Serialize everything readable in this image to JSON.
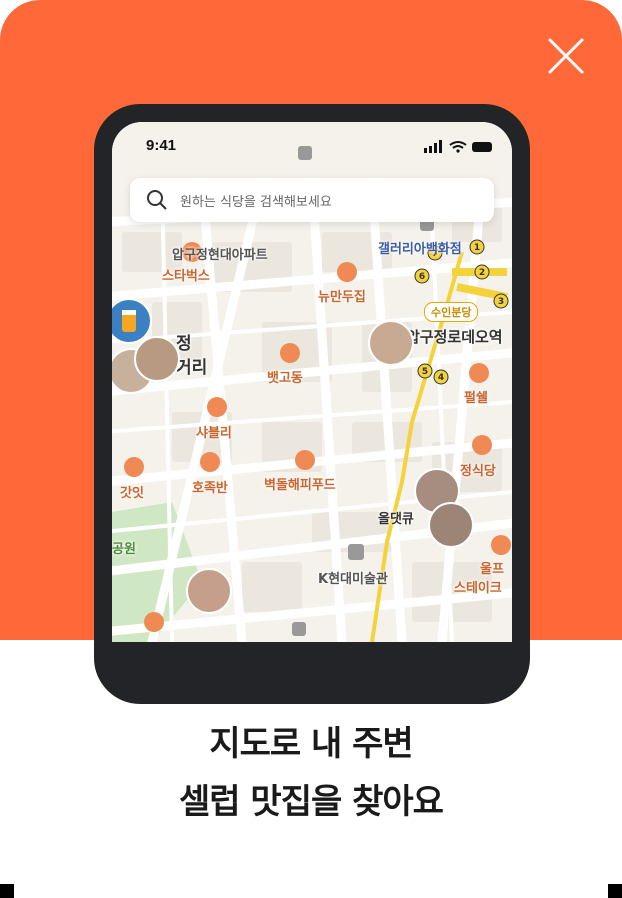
{
  "colors": {
    "accent": "#FF6838",
    "mapBg": "#F5F2EC",
    "road": "#FFFFFF",
    "poi": "#F08A55",
    "transit": "#F3D23B"
  },
  "status": {
    "time": "9:41"
  },
  "search": {
    "placeholder": "원하는 식당을 검색해보세요"
  },
  "map": {
    "places": [
      "스타벅스",
      "뉴만두집",
      "뱃고동",
      "샤블리",
      "호족반",
      "벽돌해피푸드",
      "펄쉘",
      "정식당",
      "갓잇",
      "올댓큐",
      "울프",
      "스테이크"
    ],
    "landmarks": [
      "압구정현대아파트",
      "갤러리아백화점",
      "K현대미술관",
      "공원"
    ],
    "station_badge": "수인분당",
    "station_name": "압구정로데오역",
    "crossroad_label": "정\n거리",
    "line_numbers": [
      "1",
      "2",
      "3",
      "4",
      "5",
      "6",
      "7"
    ]
  },
  "headline": {
    "line1": "지도로 내 주변",
    "line2": "셀럽 맛집을 찾아요"
  }
}
